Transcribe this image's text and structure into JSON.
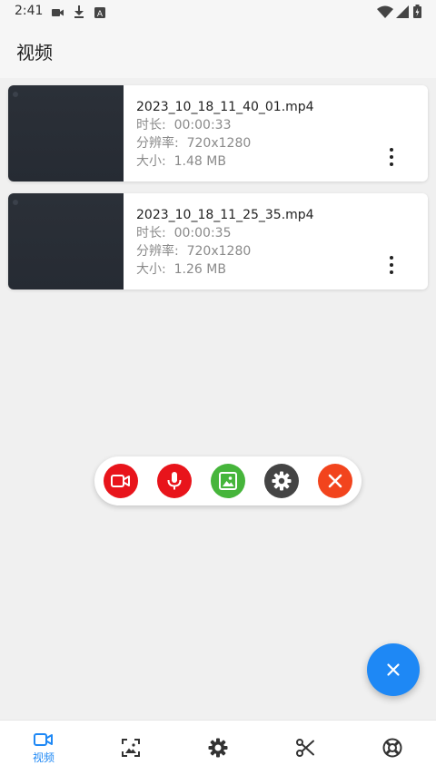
{
  "status_bar": {
    "time": "2:41",
    "icons": [
      "video-camera-icon",
      "download-icon",
      "text-a-icon",
      "wifi-icon",
      "signal-icon",
      "battery-icon"
    ]
  },
  "app_bar": {
    "title": "视频"
  },
  "videos": [
    {
      "name": "2023_10_18_11_40_01.mp4",
      "duration": "时长:  00:00:33",
      "resolution": "分辨率:  720x1280",
      "size": "大小:  1.48 MB"
    },
    {
      "name": "2023_10_18_11_25_35.mp4",
      "duration": "时长:  00:00:35",
      "resolution": "分辨率:  720x1280",
      "size": "大小:  1.26 MB"
    }
  ],
  "floating_toolbar": {
    "buttons": [
      {
        "icon": "record-video-icon",
        "color": "#e8141b"
      },
      {
        "icon": "microphone-icon",
        "color": "#e8141b"
      },
      {
        "icon": "screenshot-icon",
        "color": "#46b53b"
      },
      {
        "icon": "settings-icon",
        "color": "#444444"
      },
      {
        "icon": "close-icon",
        "color": "#f2441d"
      }
    ]
  },
  "fab": {
    "icon": "close-icon",
    "color": "#1e88f5"
  },
  "bottom_nav": {
    "items": [
      {
        "icon": "video-camera-icon",
        "label": "视频",
        "active": true
      },
      {
        "icon": "image-icon",
        "label": ""
      },
      {
        "icon": "settings-icon",
        "label": ""
      },
      {
        "icon": "scissors-icon",
        "label": ""
      },
      {
        "icon": "lifebuoy-icon",
        "label": ""
      }
    ],
    "active_color": "#1e88f5",
    "inactive_color": "#333333"
  }
}
